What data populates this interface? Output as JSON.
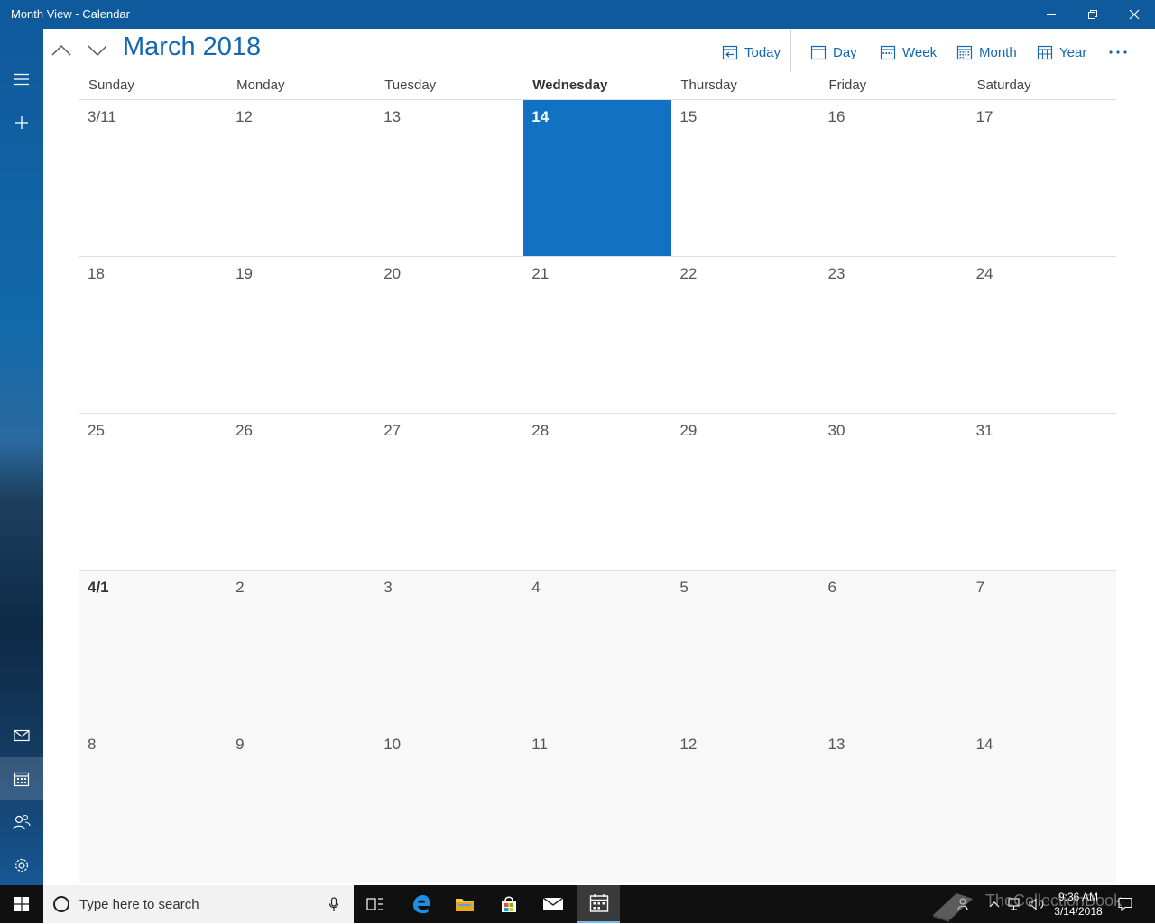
{
  "window": {
    "title": "Month View - Calendar",
    "controls": [
      "minimize-icon",
      "restore-icon",
      "close-icon"
    ]
  },
  "sidebar": {
    "items": [
      {
        "icon": "hamburger-icon",
        "name": "menu"
      },
      {
        "icon": "plus-icon",
        "name": "new-event"
      },
      {
        "icon": "mail-icon",
        "name": "mail"
      },
      {
        "icon": "calendar-icon",
        "name": "calendar",
        "active": true
      },
      {
        "icon": "people-icon",
        "name": "people"
      },
      {
        "icon": "gear-icon",
        "name": "settings"
      }
    ]
  },
  "header": {
    "month_title": "March 2018",
    "today_label": "Today",
    "day_label": "Day",
    "week_label": "Week",
    "month_label": "Month",
    "year_label": "Year"
  },
  "weekdays": [
    "Sunday",
    "Monday",
    "Tuesday",
    "Wednesday",
    "Thursday",
    "Friday",
    "Saturday"
  ],
  "today_weekday_index": 3,
  "weeks": [
    {
      "next_month": false,
      "days": [
        "3/11",
        "12",
        "13",
        "14",
        "15",
        "16",
        "17"
      ]
    },
    {
      "next_month": false,
      "days": [
        "18",
        "19",
        "20",
        "21",
        "22",
        "23",
        "24"
      ]
    },
    {
      "next_month": false,
      "days": [
        "25",
        "26",
        "27",
        "28",
        "29",
        "30",
        "31"
      ]
    },
    {
      "next_month": true,
      "days": [
        "4/1",
        "2",
        "3",
        "4",
        "5",
        "6",
        "7"
      ]
    },
    {
      "next_month": true,
      "days": [
        "8",
        "9",
        "10",
        "11",
        "12",
        "13",
        "14"
      ]
    }
  ],
  "today_cell": {
    "week": 0,
    "day": 3
  },
  "bold_cells": [
    {
      "week": 3,
      "day": 0
    }
  ],
  "colors": {
    "accent": "#1171c2",
    "titlebar": "#0f5a9c",
    "link": "#1467b0"
  },
  "taskbar": {
    "search_placeholder": "Type here to search",
    "time": "9:36 AM",
    "date": "3/14/2018",
    "watermark": "TheCollectionBook"
  }
}
